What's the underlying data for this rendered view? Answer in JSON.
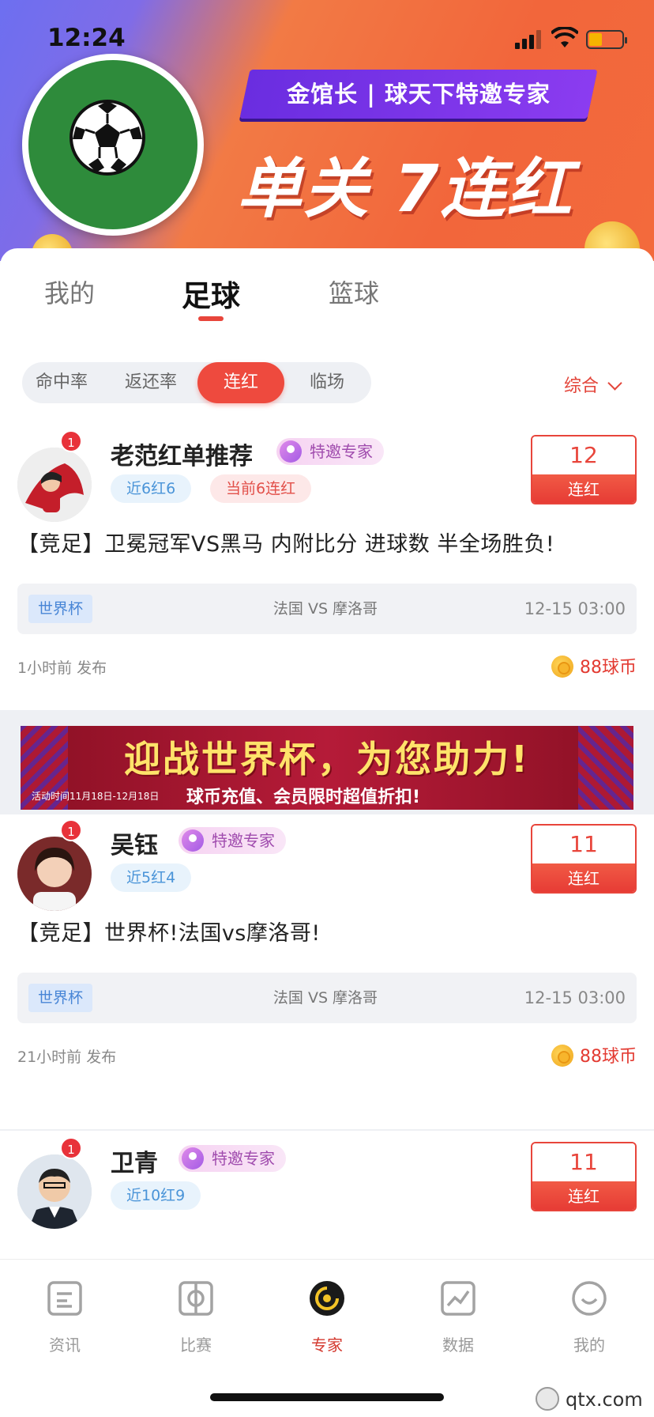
{
  "status_bar": {
    "time": "12:24"
  },
  "banner": {
    "ribbon_text": "金馆长 | 球天下特邀专家",
    "headline": "单关 7连红"
  },
  "tabs": [
    {
      "label": "我的",
      "active": false
    },
    {
      "label": "足球",
      "active": true
    },
    {
      "label": "篮球",
      "active": false
    }
  ],
  "filters": [
    {
      "label": "命中率",
      "active": false
    },
    {
      "label": "返还率",
      "active": false
    },
    {
      "label": "连红",
      "active": true
    },
    {
      "label": "临场",
      "active": false
    }
  ],
  "sort": {
    "label": "综合"
  },
  "experts": [
    {
      "name": "老范红单推荐",
      "badge_count": "1",
      "tag": "特邀专家",
      "chips": [
        {
          "text": "近6红6",
          "style": "blue"
        },
        {
          "text": "当前6连红",
          "style": "pink"
        }
      ],
      "streak_num": "12",
      "streak_label": "连红",
      "title": "【竞足】卫冕冠军VS黑马 内附比分 进球数 半全场胜负!",
      "match": {
        "league": "世界杯",
        "teams": "法国  VS  摩洛哥",
        "time": "12-15 03:00"
      },
      "posted": "1小时前 发布",
      "price": "88球币"
    },
    {
      "name": "吴钰",
      "badge_count": "1",
      "tag": "特邀专家",
      "chips": [
        {
          "text": "近5红4",
          "style": "blue"
        }
      ],
      "streak_num": "11",
      "streak_label": "连红",
      "title": "【竞足】世界杯!法国vs摩洛哥!",
      "match": {
        "league": "世界杯",
        "teams": "法国  VS  摩洛哥",
        "time": "12-15 03:00"
      },
      "posted": "21小时前 发布",
      "price": "88球币"
    },
    {
      "name": "卫青",
      "badge_count": "1",
      "tag": "特邀专家",
      "chips": [
        {
          "text": "近10红9",
          "style": "blue"
        }
      ],
      "streak_num": "11",
      "streak_label": "连红"
    }
  ],
  "promo": {
    "headline": "迎战世界杯，为您助力!",
    "subline": "球币充值、会员限时超值折扣!",
    "period": "活动时间11月18日-12月18日"
  },
  "bottom_nav": [
    {
      "label": "资讯",
      "icon": "news-icon",
      "active": false
    },
    {
      "label": "比赛",
      "icon": "match-icon",
      "active": false
    },
    {
      "label": "专家",
      "icon": "expert-icon",
      "active": true
    },
    {
      "label": "数据",
      "icon": "data-chart-icon",
      "active": false
    },
    {
      "label": "我的",
      "icon": "profile-icon",
      "active": false
    }
  ],
  "watermark": "qtx.com",
  "colors": {
    "accent": "#E8453B",
    "purple_tag": "#A04CAE",
    "blue_chip": "#4A94D8"
  }
}
